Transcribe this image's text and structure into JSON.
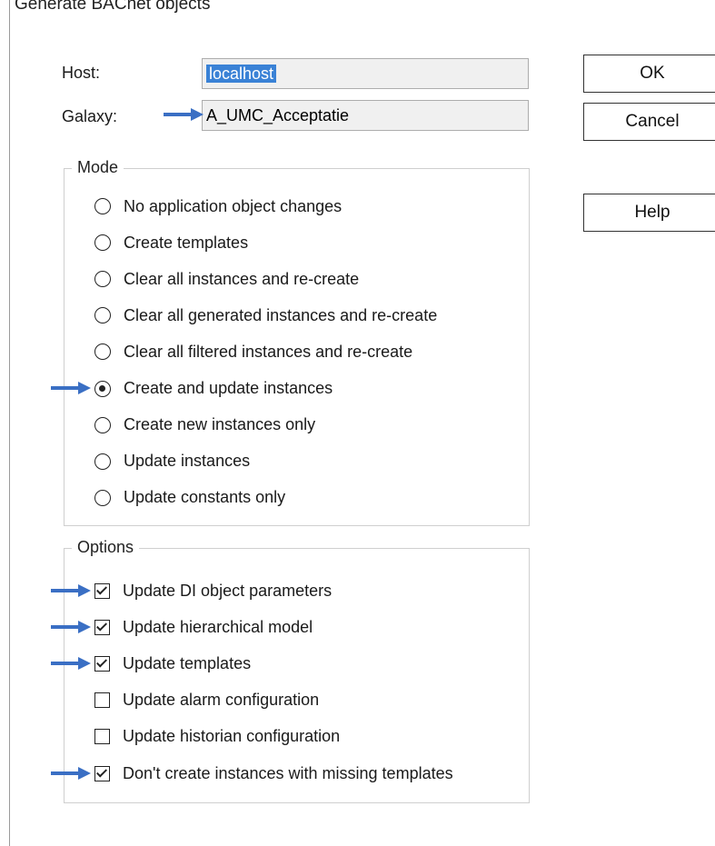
{
  "dialog": {
    "title": "Generate BACnet objects"
  },
  "fields": {
    "host_label": "Host:",
    "host_value": "localhost",
    "galaxy_label": "Galaxy:",
    "galaxy_value": "A_UMC_Acceptatie"
  },
  "buttons": {
    "ok": "OK",
    "cancel": "Cancel",
    "help": "Help"
  },
  "mode": {
    "legend": "Mode",
    "options": [
      {
        "label": "No application object changes",
        "selected": false
      },
      {
        "label": "Create templates",
        "selected": false
      },
      {
        "label": "Clear all instances and re-create",
        "selected": false
      },
      {
        "label": "Clear all generated instances and re-create",
        "selected": false
      },
      {
        "label": "Clear all filtered instances and re-create",
        "selected": false
      },
      {
        "label": "Create and update instances",
        "selected": true
      },
      {
        "label": "Create new instances only",
        "selected": false
      },
      {
        "label": "Update instances",
        "selected": false
      },
      {
        "label": "Update constants only",
        "selected": false
      }
    ]
  },
  "options": {
    "legend": "Options",
    "items": [
      {
        "label": "Update DI object parameters",
        "checked": true
      },
      {
        "label": "Update hierarchical model",
        "checked": true
      },
      {
        "label": "Update templates",
        "checked": true
      },
      {
        "label": "Update alarm configuration",
        "checked": false
      },
      {
        "label": "Update historian configuration",
        "checked": false
      },
      {
        "label": "Don't create instances with missing templates",
        "checked": true
      }
    ]
  },
  "colors": {
    "arrow": "#3a6fc4",
    "selection": "#3a82d6"
  }
}
